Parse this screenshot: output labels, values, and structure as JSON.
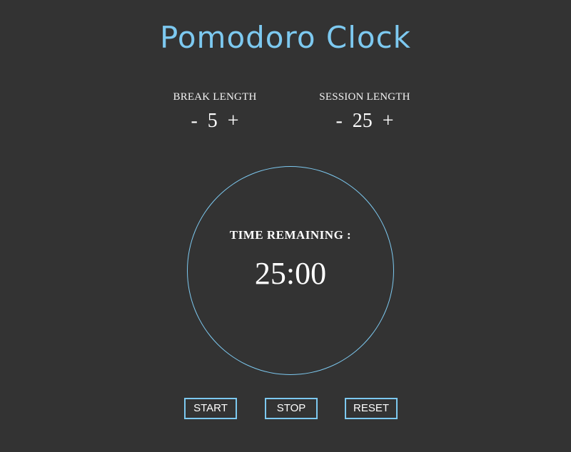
{
  "app": {
    "title": "Pomodoro Clock",
    "accent_color": "#7dc9f0",
    "background_color": "#333333"
  },
  "break": {
    "label": "BREAK LENGTH",
    "decrement": "-",
    "value": "5",
    "increment": "+"
  },
  "session": {
    "label": "SESSION LENGTH",
    "decrement": "-",
    "value": "25",
    "increment": "+"
  },
  "timer": {
    "label": "TIME REMAINING :",
    "value": "25:00"
  },
  "controls": {
    "start": "START",
    "stop": "STOP",
    "reset": "RESET"
  }
}
